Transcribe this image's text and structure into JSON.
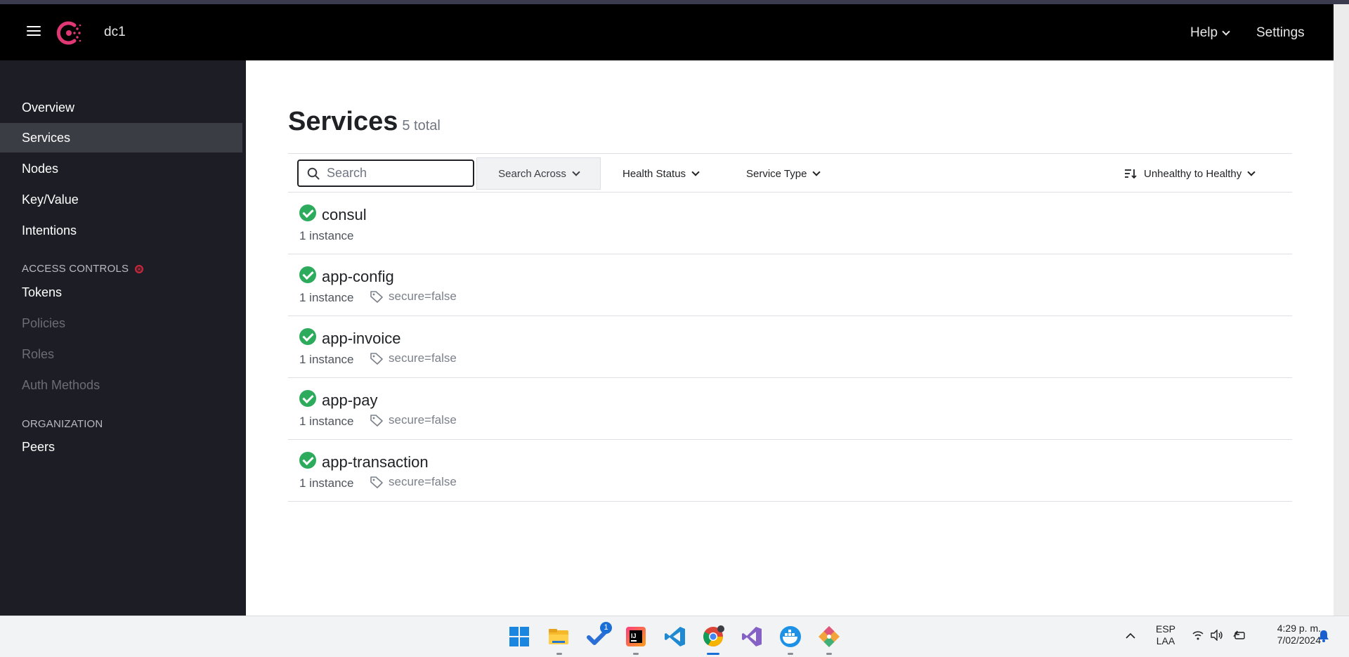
{
  "header": {
    "cluster": "dc1",
    "help_label": "Help",
    "settings_label": "Settings",
    "brand_color": "#e03875"
  },
  "sidebar": {
    "items": [
      {
        "label": "Overview"
      },
      {
        "label": "Services"
      },
      {
        "label": "Nodes"
      },
      {
        "label": "Key/Value"
      },
      {
        "label": "Intentions"
      }
    ],
    "access_controls_title": "ACCESS CONTROLS",
    "access_items": [
      {
        "label": "Tokens"
      },
      {
        "label": "Policies"
      },
      {
        "label": "Roles"
      },
      {
        "label": "Auth Methods"
      }
    ],
    "organization_title": "ORGANIZATION",
    "org_items": [
      {
        "label": "Peers"
      }
    ],
    "active": "Services"
  },
  "main": {
    "title": "Services",
    "total": "5 total",
    "search_placeholder": "Search",
    "search_across": "Search Across",
    "health_status": "Health Status",
    "service_type": "Service Type",
    "sort": "Unhealthy to Healthy",
    "services": [
      {
        "name": "consul",
        "instances": "1 instance",
        "tag": ""
      },
      {
        "name": "app-config",
        "instances": "1 instance",
        "tag": "secure=false"
      },
      {
        "name": "app-invoice",
        "instances": "1 instance",
        "tag": "secure=false"
      },
      {
        "name": "app-pay",
        "instances": "1 instance",
        "tag": "secure=false"
      },
      {
        "name": "app-transaction",
        "instances": "1 instance",
        "tag": "secure=false"
      }
    ]
  },
  "taskbar": {
    "icons": [
      "windows-start-icon",
      "file-explorer-icon",
      "todo-icon",
      "intellij-icon",
      "vscode-icon",
      "chrome-icon",
      "visual-studio-icon",
      "docker-icon",
      "git-icon"
    ],
    "todo_badge": "1",
    "lang_line1": "ESP",
    "lang_line2": "LAA",
    "time": "4:29 p. m.",
    "date": "7/02/2024"
  }
}
